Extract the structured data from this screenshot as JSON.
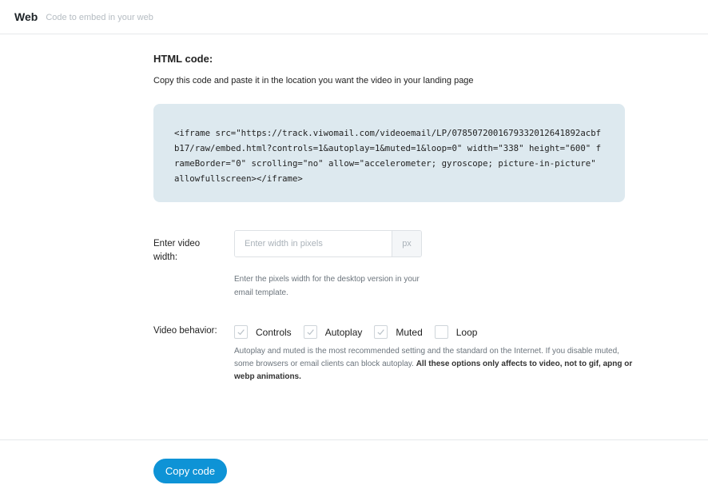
{
  "header": {
    "title": "Web",
    "subtitle": "Code to embed in your web"
  },
  "html_section": {
    "title": "HTML code:",
    "description": "Copy this code and paste it in the location you want the video in your landing page",
    "code": "<iframe src=\"https://track.viwomail.com/videoemail/LP/0785072001679332012641892acbfb17/raw/embed.html?controls=1&autoplay=1&muted=1&loop=0\" width=\"338\" height=\"600\" frameBorder=\"0\" scrolling=\"no\" allow=\"accelerometer; gyroscope; picture-in-picture\" allowfullscreen></iframe>"
  },
  "width_field": {
    "label": "Enter video width:",
    "placeholder": "Enter width in pixels",
    "value": "",
    "suffix": "px",
    "help": "Enter the pixels width for the desktop version in your email template."
  },
  "behavior": {
    "label": "Video behavior:",
    "options": [
      {
        "label": "Controls",
        "checked": true
      },
      {
        "label": "Autoplay",
        "checked": true
      },
      {
        "label": "Muted",
        "checked": true
      },
      {
        "label": "Loop",
        "checked": false
      }
    ],
    "help_text": "Autoplay and muted is the most recommended setting and the standard on the Internet. If you disable muted, some browsers or email clients can block autoplay.",
    "help_bold": "All these options only affects to video, not to gif, apng or webp animations."
  },
  "footer": {
    "copy_button": "Copy code"
  },
  "colors": {
    "accent": "#0e93d6",
    "code_background": "#dde9ef",
    "check_mark": "#b9c1c8"
  },
  "icons": {
    "checkbox_checked": "check-icon"
  }
}
